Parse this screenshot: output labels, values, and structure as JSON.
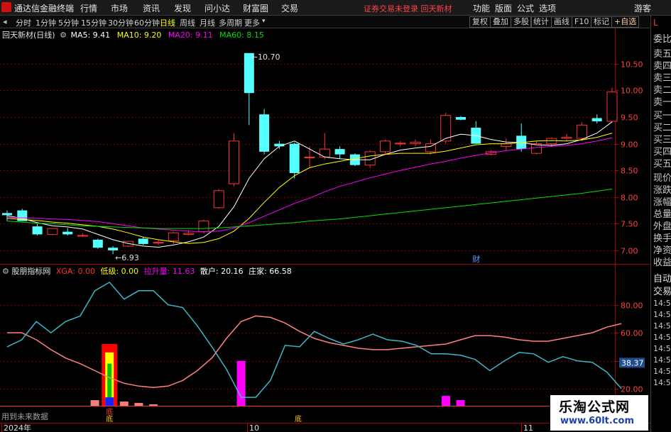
{
  "app": {
    "title": "通达信金融终端",
    "menus": [
      "行情",
      "市场",
      "资讯",
      "发现",
      "问小达",
      "财富圈",
      "交易"
    ],
    "notice": "证券交易未登录 回天新材",
    "right_menus": [
      "功能",
      "版面",
      "公式",
      "选项"
    ],
    "guest": "游客"
  },
  "toolbar": {
    "periods": [
      "分时",
      "1分钟",
      "5分钟",
      "15分钟",
      "30分钟",
      "60分钟",
      "日线",
      "周线",
      "月线",
      "多周期",
      "更多"
    ],
    "selected": "日线",
    "buttons": [
      "复权",
      "叠加",
      "多股",
      "统计",
      "画线",
      "F10",
      "标记",
      "+自选"
    ]
  },
  "main_info": {
    "name": "回天新材(日线)",
    "ma5": "MA5: 9.41",
    "ma10": "MA10: 9.20",
    "ma20": "MA20: 9.11",
    "ma60": "MA60: 8.15",
    "high_label": "10.70",
    "low_label": "6.93",
    "cai": "财"
  },
  "sub_info": {
    "name": "股朋指标网",
    "xga": "XGA: 0.00",
    "diji": "低级: 0.00",
    "lashengliang": "拉升量: 11.63",
    "sanhu": "散户: 20.16",
    "zhuangjia": "庄家: 66.58",
    "current": "38.37",
    "future_note": "用到未来数据",
    "di_marks": [
      "底",
      "底",
      "底"
    ]
  },
  "sidebar": {
    "header": "L",
    "quote_labels": [
      "委比",
      "卖五",
      "卖四",
      "卖三",
      "卖二",
      "卖一",
      "买一",
      "买二",
      "买三",
      "买四",
      "买五",
      "现价",
      "涨跌",
      "涨幅",
      "总量",
      "外盘",
      "换手",
      "净资",
      "收益"
    ],
    "bottom_labels": [
      "自动",
      "交易"
    ],
    "times": [
      "14:56",
      "14:56",
      "14:56",
      "14:56",
      "14:56",
      "14:56",
      "14:56",
      "14:56"
    ]
  },
  "xaxis": {
    "labels": [
      "2024年",
      "10",
      "11"
    ]
  },
  "colors": {
    "up": "#ff3232",
    "down": "#54ffff",
    "ma5": "#ffffff",
    "ma10": "#ffff00",
    "ma20": "#ff00ff",
    "ma60": "#00e000",
    "sanhu": "#ff8080",
    "zhuangjia": "#3ab8c8",
    "grid": "#7a0000"
  },
  "chart_data": [
    {
      "type": "candlestick",
      "title": "回天新材(日线)",
      "ylim": [
        6.8,
        10.95
      ],
      "yticks": [
        7.0,
        7.5,
        8.0,
        8.5,
        9.0,
        9.5,
        10.0,
        10.5
      ],
      "candles": [
        {
          "o": 7.7,
          "h": 7.75,
          "l": 7.55,
          "c": 7.66
        },
        {
          "o": 7.75,
          "h": 7.78,
          "l": 7.55,
          "c": 7.55
        },
        {
          "o": 7.45,
          "h": 7.5,
          "l": 7.28,
          "c": 7.3
        },
        {
          "o": 7.3,
          "h": 7.42,
          "l": 7.28,
          "c": 7.41
        },
        {
          "o": 7.35,
          "h": 7.42,
          "l": 7.28,
          "c": 7.3
        },
        {
          "o": 7.28,
          "h": 7.32,
          "l": 7.25,
          "c": 7.28
        },
        {
          "o": 7.2,
          "h": 7.22,
          "l": 7.03,
          "c": 7.05
        },
        {
          "o": 7.05,
          "h": 7.08,
          "l": 6.93,
          "c": 7.0
        },
        {
          "o": 7.08,
          "h": 7.18,
          "l": 7.06,
          "c": 7.17
        },
        {
          "o": 7.22,
          "h": 7.25,
          "l": 7.1,
          "c": 7.12
        },
        {
          "o": 7.15,
          "h": 7.2,
          "l": 7.1,
          "c": 7.15
        },
        {
          "o": 7.18,
          "h": 7.35,
          "l": 7.12,
          "c": 7.33
        },
        {
          "o": 7.3,
          "h": 7.38,
          "l": 7.28,
          "c": 7.32
        },
        {
          "o": 7.35,
          "h": 7.58,
          "l": 7.32,
          "c": 7.55
        },
        {
          "o": 7.8,
          "h": 8.15,
          "l": 7.78,
          "c": 8.12
        },
        {
          "o": 8.25,
          "h": 9.2,
          "l": 8.2,
          "c": 9.05
        },
        {
          "o": 10.7,
          "h": 10.7,
          "l": 9.35,
          "c": 9.95
        },
        {
          "o": 9.55,
          "h": 9.65,
          "l": 8.8,
          "c": 8.85
        },
        {
          "o": 9.0,
          "h": 9.05,
          "l": 8.9,
          "c": 8.95
        },
        {
          "o": 9.0,
          "h": 9.02,
          "l": 8.35,
          "c": 8.45
        },
        {
          "o": 8.75,
          "h": 8.95,
          "l": 8.55,
          "c": 8.75
        },
        {
          "o": 8.75,
          "h": 9.2,
          "l": 8.7,
          "c": 8.9
        },
        {
          "o": 8.9,
          "h": 8.95,
          "l": 8.72,
          "c": 8.8
        },
        {
          "o": 8.8,
          "h": 8.82,
          "l": 8.58,
          "c": 8.6
        },
        {
          "o": 8.6,
          "h": 8.88,
          "l": 8.55,
          "c": 8.85
        },
        {
          "o": 8.85,
          "h": 9.08,
          "l": 8.8,
          "c": 9.05
        },
        {
          "o": 9.0,
          "h": 9.05,
          "l": 8.95,
          "c": 9.01
        },
        {
          "o": 9.0,
          "h": 9.08,
          "l": 8.95,
          "c": 9.03
        },
        {
          "o": 8.85,
          "h": 9.08,
          "l": 8.8,
          "c": 9.0
        },
        {
          "o": 9.05,
          "h": 9.58,
          "l": 9.0,
          "c": 9.53
        },
        {
          "o": 9.5,
          "h": 9.52,
          "l": 9.44,
          "c": 9.45
        },
        {
          "o": 9.3,
          "h": 9.42,
          "l": 9.0,
          "c": 9.0
        },
        {
          "o": 8.8,
          "h": 8.88,
          "l": 8.78,
          "c": 8.85
        },
        {
          "o": 8.95,
          "h": 9.1,
          "l": 8.88,
          "c": 9.0
        },
        {
          "o": 9.15,
          "h": 9.38,
          "l": 8.85,
          "c": 8.9
        },
        {
          "o": 8.82,
          "h": 9.05,
          "l": 8.8,
          "c": 9.0
        },
        {
          "o": 9.0,
          "h": 9.12,
          "l": 8.95,
          "c": 9.1
        },
        {
          "o": 9.1,
          "h": 9.18,
          "l": 9.05,
          "c": 9.12
        },
        {
          "o": 9.1,
          "h": 9.4,
          "l": 9.05,
          "c": 9.35
        },
        {
          "o": 9.48,
          "h": 9.55,
          "l": 9.38,
          "c": 9.42
        },
        {
          "o": 9.42,
          "h": 10.05,
          "l": 9.4,
          "c": 9.97
        }
      ],
      "series": [
        {
          "name": "MA5",
          "values": [
            7.65,
            7.6,
            7.52,
            7.46,
            7.44,
            7.4,
            7.3,
            7.2,
            7.13,
            7.08,
            7.06,
            7.1,
            7.16,
            7.25,
            7.45,
            7.82,
            8.35,
            8.72,
            8.95,
            9.05,
            8.9,
            8.75,
            8.72,
            8.7,
            8.7,
            8.8,
            8.88,
            8.92,
            8.95,
            9.1,
            9.18,
            9.15,
            9.08,
            9.03,
            9.02,
            8.98,
            8.97,
            9.0,
            9.08,
            9.2,
            9.41
          ]
        },
        {
          "name": "MA10",
          "values": [
            7.6,
            7.58,
            7.56,
            7.53,
            7.51,
            7.48,
            7.45,
            7.4,
            7.33,
            7.25,
            7.2,
            7.16,
            7.13,
            7.15,
            7.22,
            7.36,
            7.6,
            7.9,
            8.18,
            8.4,
            8.55,
            8.62,
            8.67,
            8.72,
            8.77,
            8.8,
            8.82,
            8.82,
            8.82,
            8.86,
            8.92,
            8.98,
            9.0,
            9.0,
            9.02,
            9.05,
            9.06,
            9.05,
            9.07,
            9.12,
            9.2
          ]
        },
        {
          "name": "MA20",
          "values": [
            7.62,
            7.61,
            7.6,
            7.59,
            7.58,
            7.56,
            7.54,
            7.5,
            7.46,
            7.42,
            7.4,
            7.38,
            7.36,
            7.35,
            7.36,
            7.42,
            7.52,
            7.64,
            7.76,
            7.88,
            7.98,
            8.1,
            8.2,
            8.28,
            8.36,
            8.43,
            8.5,
            8.56,
            8.62,
            8.67,
            8.73,
            8.78,
            8.83,
            8.87,
            8.9,
            8.93,
            8.95,
            8.97,
            9.0,
            9.05,
            9.11
          ]
        },
        {
          "name": "MA60",
          "values": [
            7.55,
            7.53,
            7.51,
            7.5,
            7.48,
            7.46,
            7.45,
            7.44,
            7.43,
            7.42,
            7.41,
            7.41,
            7.41,
            7.41,
            7.42,
            7.44,
            7.46,
            7.48,
            7.5,
            7.52,
            7.55,
            7.57,
            7.59,
            7.62,
            7.65,
            7.68,
            7.71,
            7.74,
            7.77,
            7.8,
            7.83,
            7.86,
            7.89,
            7.92,
            7.95,
            7.98,
            8.01,
            8.04,
            8.07,
            8.11,
            8.15
          ]
        }
      ]
    },
    {
      "type": "line",
      "title": "股朋指标网",
      "ylim": [
        8,
        100
      ],
      "yticks": [
        20,
        40,
        60,
        80
      ],
      "series": [
        {
          "name": "散户",
          "values": [
            60,
            60,
            55,
            48,
            42,
            38,
            33,
            28,
            24,
            22,
            21,
            22,
            26,
            33,
            42,
            56,
            68,
            72,
            71,
            67,
            61,
            56,
            53,
            51,
            49,
            48,
            48,
            49,
            50,
            51,
            52,
            55,
            58,
            58,
            57,
            55,
            54,
            54,
            56,
            58,
            60,
            64,
            66.58
          ]
        },
        {
          "name": "庄家",
          "values": [
            50,
            55,
            68,
            60,
            68,
            72,
            90,
            96,
            84,
            90,
            90,
            80,
            78,
            65,
            50,
            34,
            14,
            14,
            26,
            51,
            50,
            61,
            56,
            52,
            55,
            59,
            55,
            54,
            51,
            45,
            45,
            44,
            41,
            33,
            40,
            46,
            45,
            39,
            43,
            40,
            39,
            32,
            20.16
          ]
        }
      ],
      "bars_magenta": [
        {
          "i": 16,
          "v": 40
        },
        {
          "i": 30,
          "v": 15
        },
        {
          "i": 31,
          "v": 12
        }
      ],
      "bars_pink": [
        {
          "i": 6,
          "v": 12
        },
        {
          "i": 8,
          "v": 11
        },
        {
          "i": 9,
          "v": 10
        },
        {
          "i": 10,
          "v": 9
        }
      ],
      "big_signal_index": 7
    }
  ]
}
